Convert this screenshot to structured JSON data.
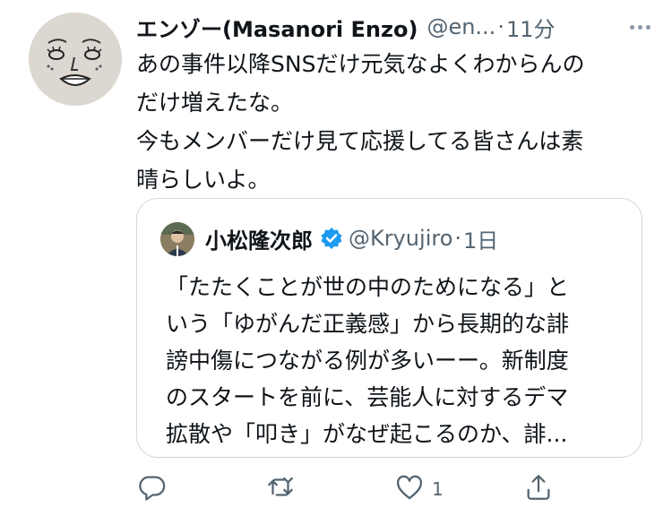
{
  "tweet": {
    "author_name": "エンゾー(Masanori Enzo)",
    "handle": "@en...",
    "separator": "·",
    "time": "11分",
    "text_lines": [
      "あの事件以降SNSだけ元気なよくわからんの",
      "だけ増えたな。",
      "今もメンバーだけ見て応援してる皆さんは素",
      "晴らしいよ。"
    ]
  },
  "quoted": {
    "author_name": "小松隆次郎",
    "handle": "@Kryujiro",
    "separator": "·",
    "time": "1日",
    "text_lines": [
      "「たたくことが世の中のためになる」と",
      "いう「ゆがんだ正義感」から長期的な誹",
      "謗中傷につながる例が多いーー。新制度",
      "のスタートを前に、芸能人に対するデマ",
      "拡散や「叩き」がなぜ起こるのか、誹..."
    ]
  },
  "actions": {
    "reply_count": "",
    "retweet_count": "",
    "like_count": "1"
  },
  "colors": {
    "text": "#0f1419",
    "secondary": "#536471",
    "verified": "#1d9bf0",
    "border": "#cfd9de"
  }
}
